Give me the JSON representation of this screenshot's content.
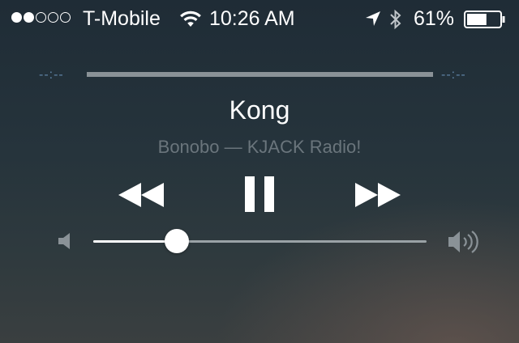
{
  "status_bar": {
    "signal_bars_filled": 2,
    "signal_bars_total": 5,
    "carrier": "T-Mobile",
    "time": "10:26 AM",
    "battery_percent_label": "61%",
    "battery_level": 0.61,
    "icons": [
      "signal-dots-icon",
      "wifi-icon",
      "location-arrow-icon",
      "bluetooth-icon",
      "battery-icon"
    ]
  },
  "scrubber": {
    "elapsed": "--:--",
    "remaining": "--:--"
  },
  "now_playing": {
    "title": "Kong",
    "subtitle": "Bonobo — KJACK Radio!"
  },
  "controls": {
    "icons": [
      "rewind-icon",
      "pause-icon",
      "fast-forward-icon"
    ]
  },
  "volume": {
    "level": 0.25,
    "icons": [
      "volume-min-icon",
      "volume-max-icon"
    ]
  },
  "colors": {
    "accent_time": "#5f84a6",
    "subtitle": "#6a757c",
    "track": "#8a9297"
  }
}
